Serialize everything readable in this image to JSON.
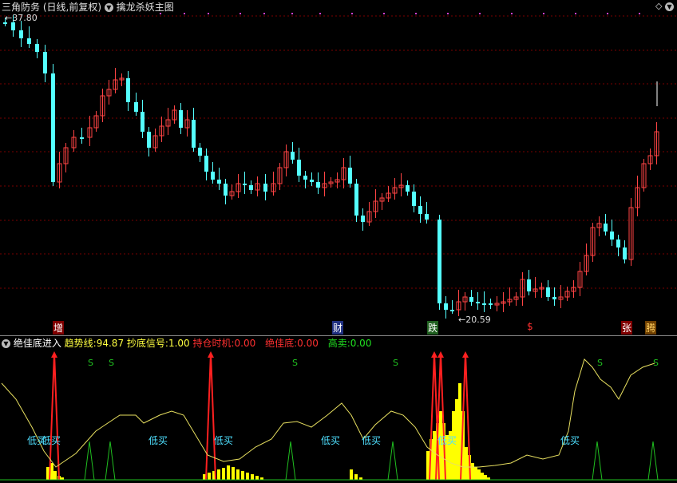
{
  "header": {
    "title": "三角防务",
    "period": "(日线,前复权)",
    "indicator": "擒龙杀妖主图",
    "price_high": "37.80",
    "price_low": "20.59"
  },
  "markers": [
    "增",
    "财",
    "跌",
    "$",
    "张",
    "腾"
  ],
  "sub_header": {
    "name": "绝佳底进入",
    "trend_label": "趋势线:",
    "trend_value": "94.87",
    "signal_label": "抄底信号:",
    "signal_value": "1.00",
    "hold_label": "持仓时机:",
    "hold_value": "0.00",
    "bottom_label": "绝佳底:",
    "bottom_value": "0.00",
    "sell_label": "高卖:",
    "sell_value": "0.00"
  },
  "sub_labels": {
    "buy": "低买",
    "sell_s": "S"
  },
  "colors": {
    "up": "#ff4444",
    "down": "#54ffff",
    "grid": "#7a0000",
    "yellow": "#ffff00",
    "red_arrow": "#ff2020",
    "green": "#20c020",
    "cyan_text": "#4fe0ff"
  }
}
